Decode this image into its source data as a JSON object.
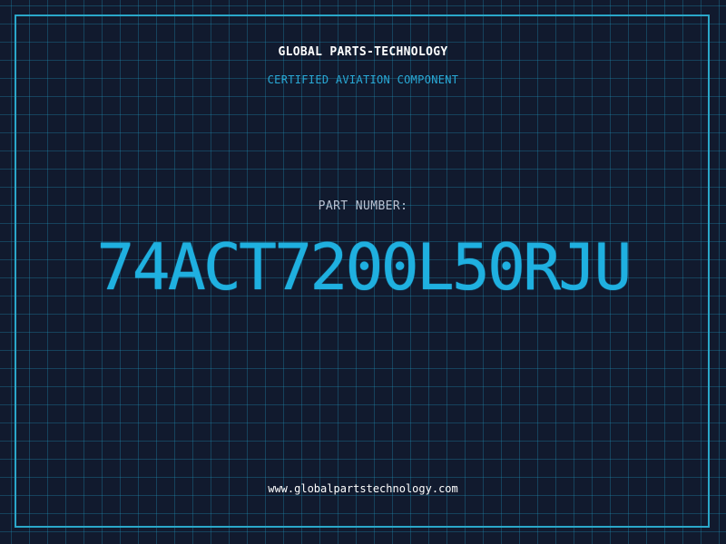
{
  "header": {
    "company": "GLOBAL PARTS-TECHNOLOGY",
    "subtitle": "CERTIFIED AVIATION COMPONENT"
  },
  "part": {
    "label": "PART NUMBER:",
    "number": "74ACT7200L50RJU"
  },
  "footer": {
    "website": "www.globalpartstechnology.com"
  },
  "colors": {
    "background": "#111a2e",
    "grid": "#1e96be",
    "accent": "#1fb0e0",
    "frame": "#2aa7c9",
    "label": "#b9c3d3",
    "text": "#ffffff"
  }
}
